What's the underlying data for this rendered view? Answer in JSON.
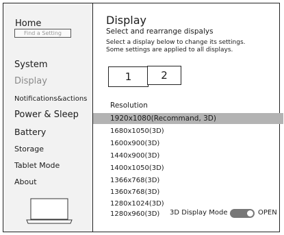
{
  "sidebar": {
    "home": "Home",
    "search_placeholder": "Find a Setting",
    "items": [
      {
        "label": "System"
      },
      {
        "label": "Display"
      },
      {
        "label": "Notifications&actions"
      },
      {
        "label": "Power & Sleep"
      },
      {
        "label": "Battery"
      },
      {
        "label": "Storage"
      },
      {
        "label": "Tablet Mode"
      },
      {
        "label": "About"
      }
    ],
    "selected": "Display"
  },
  "main": {
    "title": "Display",
    "subtitle": "Select and rearrange dispalys",
    "description_line1": "Select a display below to change its settings.",
    "description_line2": "Some settings are applied to all displays.",
    "monitors": [
      "1",
      "2"
    ],
    "resolution_label": "Resolution",
    "resolutions": [
      "1920x1080(Recommand, 3D)",
      "1680x1050(3D)",
      "1600x900(3D)",
      "1440x900(3D)",
      "1400x1050(3D)",
      "1366x768(3D)",
      "1360x768(3D)",
      "1280x1024(3D)",
      "1280x960(3D)"
    ],
    "selected_resolution": "1920x1080(Recommand, 3D)",
    "mode_label": "3D Display Mode",
    "mode_state": "OPEN",
    "mode_on": true
  },
  "colors": {
    "highlight": "#b3b3b3",
    "toggle": "#777777",
    "sidebar_bg": "#f2f2f2"
  }
}
